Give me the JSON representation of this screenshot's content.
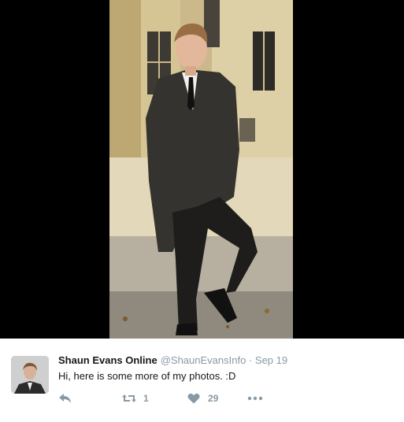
{
  "tweet": {
    "name": "Shaun Evans Online",
    "handle": "@ShaunEvansInfo",
    "separator": "·",
    "time": "Sep 19",
    "text": "Hi, here is some more of my photos. :D",
    "retweet_count": "1",
    "like_count": "29"
  },
  "icons": {
    "reply": "reply-icon",
    "retweet": "retweet-icon",
    "like": "heart-icon",
    "more": "more-dots-icon"
  },
  "colors": {
    "secondary_text": "#8899a6",
    "primary_text": "#14171a",
    "media_background": "#000000"
  }
}
